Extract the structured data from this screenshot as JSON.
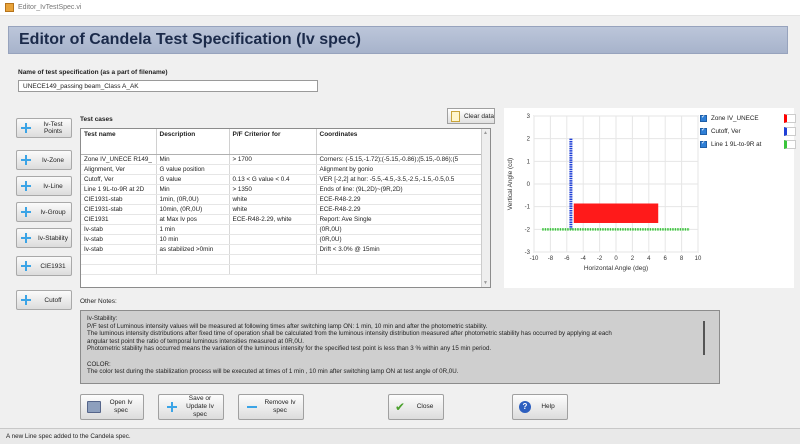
{
  "window": {
    "title": "Editor_IvTestSpec.vi"
  },
  "header": {
    "title": "Editor of Candela Test Specification (Iv spec)"
  },
  "spec_name": {
    "label": "Name of test specification (as a part of filename)",
    "value": "UNECE149_passing beam_Class A_AK"
  },
  "sidebar": {
    "buttons": [
      {
        "label": "Iv-Test Points"
      },
      {
        "label": "Iv-Zone"
      },
      {
        "label": "Iv-Line"
      },
      {
        "label": "Iv-Group"
      },
      {
        "label": "Iv-Stability"
      },
      {
        "label": "CIE1931"
      },
      {
        "label": "Cutoff"
      }
    ]
  },
  "test_cases": {
    "label": "Test cases",
    "clear_label": "Clear data",
    "columns": [
      "Test name",
      "Description",
      "P/F Criterior for",
      "Coordinates"
    ],
    "rows": [
      [
        "Zone IV_UNECE R149_",
        "Min",
        "> 1700",
        "Corners: (-5.15,-1.72);(-5.15,-0.86);(5.15,-0.86);(5"
      ],
      [
        "Alignment, Ver",
        "G value position",
        "",
        "Alignment by gonio"
      ],
      [
        "Cutoff, Ver",
        "G value",
        "0.13 < G value < 0.4",
        "VER [-2,2] at hor: -5.5,-4.5,-3.5,-2.5,-1.5,-0.5,0.5"
      ],
      [
        "Line 1 9L-to-9R at 2D",
        "Min",
        "> 1350",
        "Ends of line: (9L,2D)~(9R,2D)"
      ],
      [
        "CIE1931-stab",
        "1min, (0R,0U)",
        "white",
        "ECE-R48-2.29"
      ],
      [
        "CIE1931-stab",
        "10min, (0R,0U)",
        "white",
        "ECE-R48-2.29"
      ],
      [
        "CIE1931",
        "at Max Iv pos",
        "ECE-R48-2.29, white",
        "Report: Ave Single"
      ],
      [
        "Iv-stab",
        "1 min",
        "",
        "(0R,0U)"
      ],
      [
        "Iv-stab",
        "10 min",
        "",
        "(0R,0U)"
      ],
      [
        "Iv-stab",
        "as stabilized >0min",
        "",
        "Drift < 3.0% @ 15min"
      ],
      [
        "",
        "",
        "",
        ""
      ],
      [
        "",
        "",
        "",
        ""
      ]
    ]
  },
  "chart_data": {
    "type": "scatter",
    "xlabel": "Horizontal Angle (deg)",
    "ylabel": "Vertical Angle (cd)",
    "xlim": [
      -10,
      10
    ],
    "ylim": [
      -3,
      3
    ],
    "xticks": [
      -10,
      -8,
      -6,
      -4,
      -2,
      0,
      2,
      4,
      6,
      8,
      10
    ],
    "yticks": [
      -3,
      -2,
      -1,
      0,
      1,
      2,
      3
    ],
    "grid": true,
    "series": [
      {
        "name": "Zone IV_UNECE",
        "color": "#ff0000",
        "rect": {
          "x0": -5.15,
          "x1": 5.15,
          "y0": -1.72,
          "y1": -0.86
        }
      },
      {
        "name": "Cutoff, Ver",
        "color": "#1f3fd6",
        "x": [
          -5.5
        ],
        "y_from": -2,
        "y_to": 2
      },
      {
        "name": "Line 1 9L-to-9R at",
        "color": "#39c43a",
        "x_from": -9,
        "x_to": 9,
        "y": [
          -2
        ]
      }
    ],
    "legend": "right"
  },
  "notes": {
    "label": "Other Notes:",
    "lines": [
      "Iv-Stability:",
      "P/F test of Luminous intensity values will be measured at following times after switching lamp ON: 1 min, 10 min and after the photometric stability.",
      "The luminous intensity distributions after fixed time of operation shall be calculated from the luminous intensity distribution measured after photometric stability has occurred by applying at each",
      "angular test point the ratio of temporal luminous intensities measured at 0R,0U.",
      "Photometric stability has occurred means the variation of the luminous intensity for the specified test point is less than 3 % within any 15 min period.",
      "",
      "COLOR:",
      "The color test during the stabilization process will be executed at times of  1 min , 10 min after switching lamp ON at test angle of 0R,0U."
    ]
  },
  "buttons": {
    "open_label": "Open Iv spec",
    "save_label": "Save or Update Iv spec",
    "remove_label": "Remove Iv spec",
    "close_label": "Close",
    "help_label": "Help"
  },
  "status": {
    "text": "A new Line spec added to the Candela spec."
  }
}
